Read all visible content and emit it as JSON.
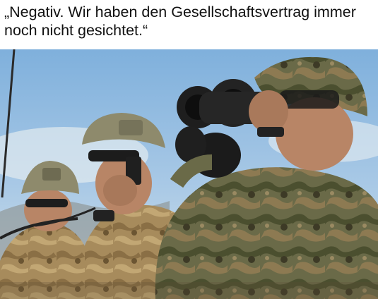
{
  "caption": {
    "text": "„Negativ. Wir haben den Gesellschaftsvertrag immer noch nicht gesichtet.“"
  },
  "photo": {
    "subject_icons": [
      "soldier-with-radio-icon",
      "soldier-with-binoculars-icon",
      "soldier-background-icon"
    ],
    "colors": {
      "sky": "#8fb9de",
      "sky_light": "#c9dcec",
      "camo_tan": "#a78b5c",
      "camo_green": "#5d6b3e",
      "camo_brown": "#6e5334",
      "helmet_tan": "#8e8a6c",
      "binocular_black": "#1e1e1e",
      "skin": "#b88566"
    }
  }
}
